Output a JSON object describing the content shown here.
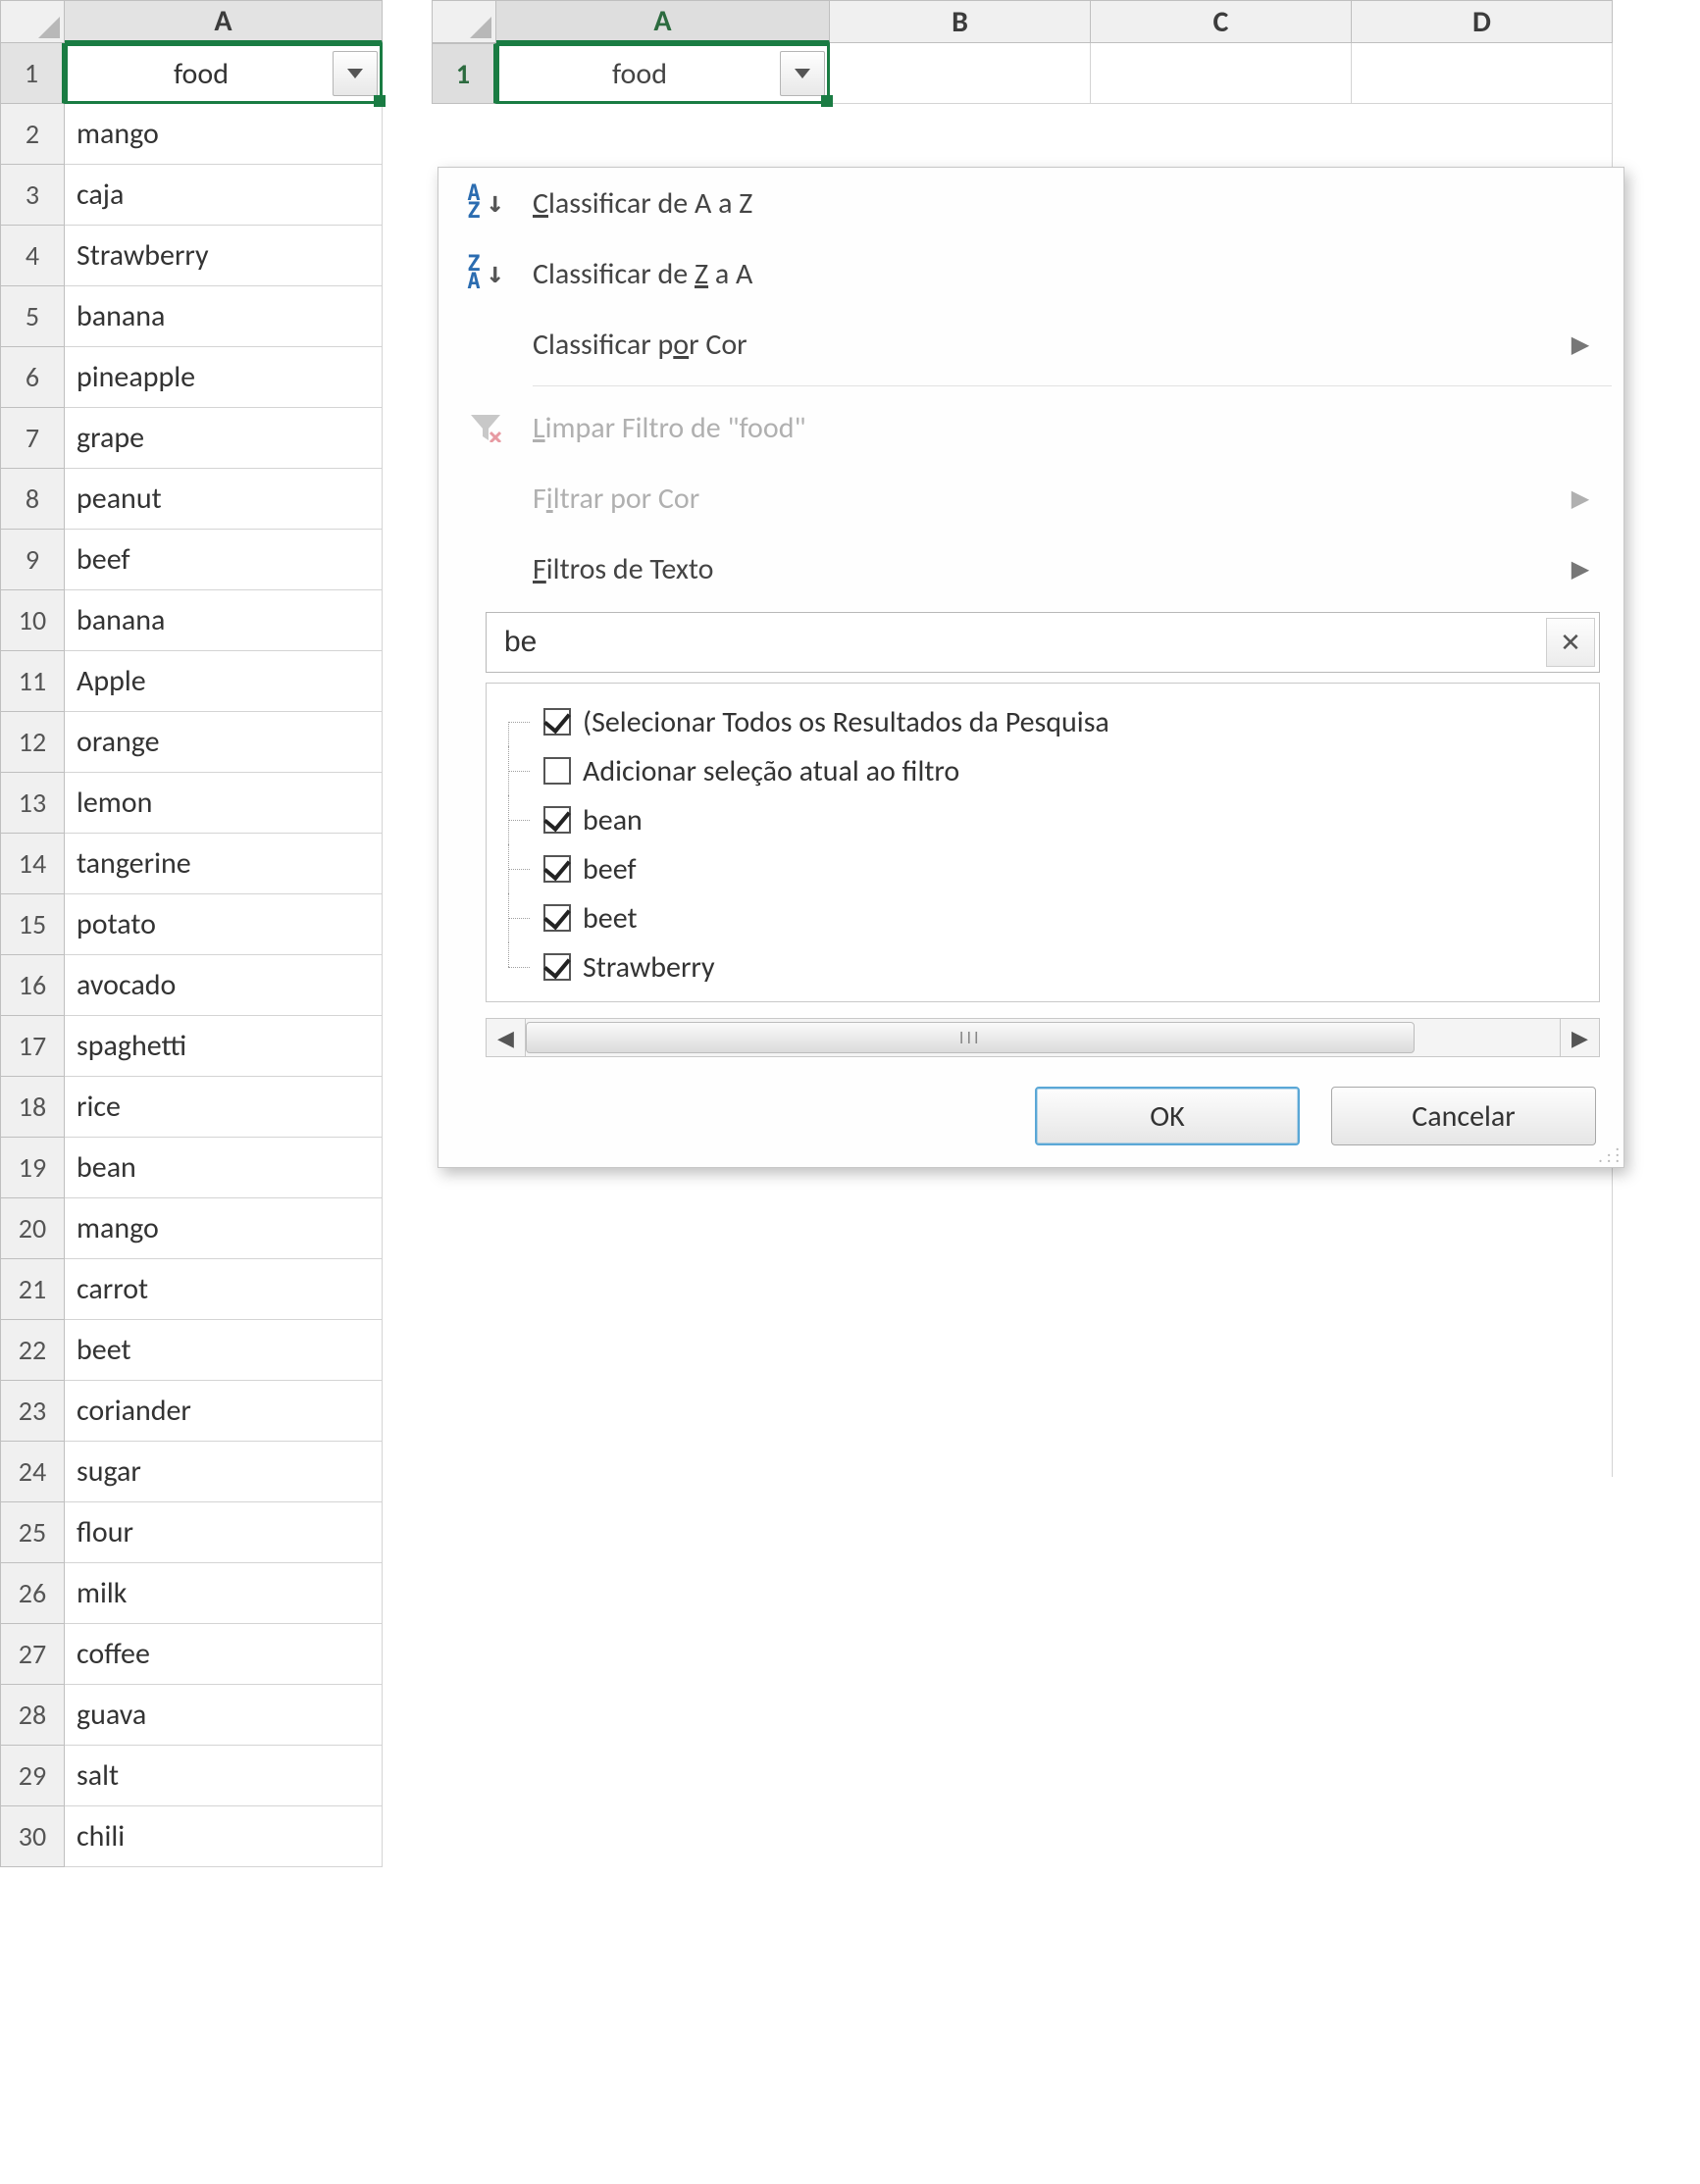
{
  "left_grid": {
    "column_letter": "A",
    "header_value": "food",
    "filter_applied": false,
    "rows": [
      {
        "n": 1,
        "v": "food",
        "is_header": true
      },
      {
        "n": 2,
        "v": "mango"
      },
      {
        "n": 3,
        "v": "caja"
      },
      {
        "n": 4,
        "v": "Strawberry"
      },
      {
        "n": 5,
        "v": "banana"
      },
      {
        "n": 6,
        "v": "pineapple"
      },
      {
        "n": 7,
        "v": "grape"
      },
      {
        "n": 8,
        "v": "peanut"
      },
      {
        "n": 9,
        "v": "beef"
      },
      {
        "n": 10,
        "v": "banana"
      },
      {
        "n": 11,
        "v": "Apple"
      },
      {
        "n": 12,
        "v": "orange"
      },
      {
        "n": 13,
        "v": "lemon"
      },
      {
        "n": 14,
        "v": "tangerine"
      },
      {
        "n": 15,
        "v": "potato"
      },
      {
        "n": 16,
        "v": "avocado"
      },
      {
        "n": 17,
        "v": "spaghetti"
      },
      {
        "n": 18,
        "v": "rice"
      },
      {
        "n": 19,
        "v": "bean"
      },
      {
        "n": 20,
        "v": "mango"
      },
      {
        "n": 21,
        "v": "carrot"
      },
      {
        "n": 22,
        "v": "beet"
      },
      {
        "n": 23,
        "v": "coriander"
      },
      {
        "n": 24,
        "v": "sugar"
      },
      {
        "n": 25,
        "v": "flour"
      },
      {
        "n": 26,
        "v": "milk"
      },
      {
        "n": 27,
        "v": "coffee"
      },
      {
        "n": 28,
        "v": "guava"
      },
      {
        "n": 29,
        "v": "salt"
      },
      {
        "n": 30,
        "v": "chili"
      }
    ]
  },
  "right_grid": {
    "columns": [
      "A",
      "B",
      "C",
      "D"
    ],
    "row1_number": "1",
    "cell_a1": "food"
  },
  "filter_menu": {
    "sort_az": {
      "top": "A",
      "bottom": "Z",
      "label_html": "<u>C</u>lassificar de A a Z"
    },
    "sort_za": {
      "top": "Z",
      "bottom": "A",
      "label_html": "Classificar de <u>Z</u> a A"
    },
    "sort_color": {
      "label_html": "Classificar p<u>o</u>r Cor"
    },
    "clear_filter": {
      "label_html": "<u>L</u>impar Filtro de \"food\""
    },
    "filter_color": {
      "label_html": "F<u>i</u>ltrar por Cor"
    },
    "text_filters": {
      "label_html": "<u>F</u>iltros de Texto"
    },
    "search_value": "be",
    "tree": [
      {
        "checked": true,
        "label": "(Selecionar Todos os Resultados da Pesquisa"
      },
      {
        "checked": false,
        "label": "Adicionar seleção atual ao filtro"
      },
      {
        "checked": true,
        "label": "bean"
      },
      {
        "checked": true,
        "label": "beef"
      },
      {
        "checked": true,
        "label": "beet"
      },
      {
        "checked": true,
        "label": "Strawberry"
      }
    ],
    "scroll_thumb": "III",
    "ok": "OK",
    "cancel": "Cancelar"
  }
}
